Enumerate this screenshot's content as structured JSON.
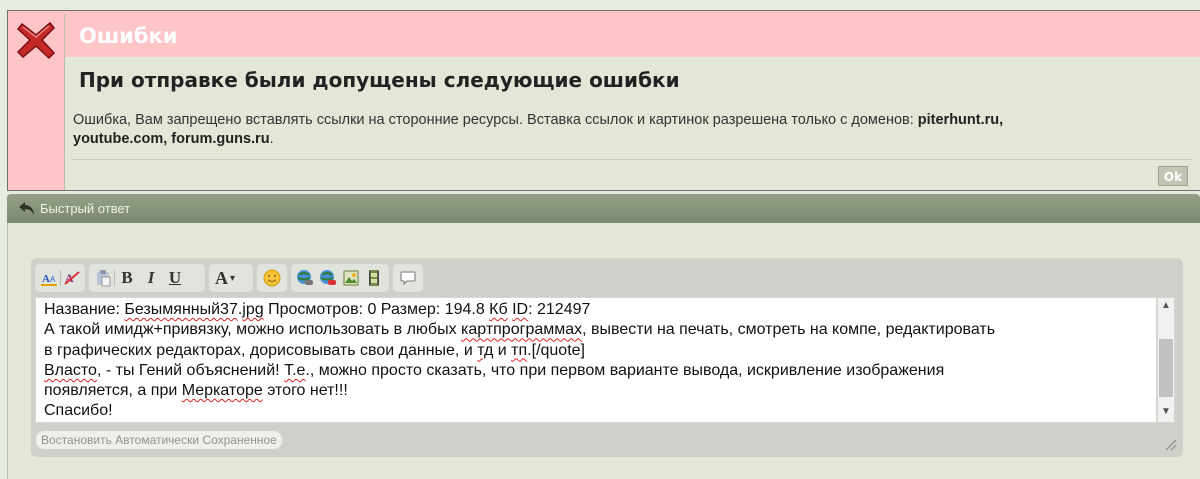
{
  "error_dialog": {
    "title": "Ошибки",
    "heading": "При отправке были допущены следующие ошибки",
    "message_text": "Ошибка, Вам запрещено вставлять ссылки на сторонние ресурсы. Вставка ссылок и картинок разрешена только с доменов: ",
    "allowed_domains_line1": "piterhunt.ru,",
    "allowed_domains_line2": "youtube.com, forum.guns.ru",
    "message_end": ".",
    "ok_label": "Ok",
    "colors": {
      "pink": "#fec5c8",
      "panel": "#e3e7d8",
      "icon_red": "#c0392b"
    }
  },
  "quick_reply": {
    "title": "Быстрый ответ",
    "header_color": "#87947b"
  },
  "toolbar": {
    "buttons": [
      "font-color-icon",
      "remove-format-icon",
      "paste-icon",
      "bold-icon",
      "italic-icon",
      "underline-icon",
      "font-size-icon",
      "smiley-icon",
      "insert-link-icon",
      "remove-link-icon",
      "insert-image-icon",
      "insert-video-icon",
      "quote-icon"
    ],
    "bold": "B",
    "italic": "I",
    "underline": "U",
    "font_size": "A",
    "font_size_arrow": "▾"
  },
  "editor": {
    "line1": "Название: Безымянный37.jpg Просмотров: 0 Размер: 194.8 Кб ID: 212497",
    "line2": "А такой имидж+привязку, можно использовать в любых картпрограммах, вывести на печать, смотреть на компе, редактировать",
    "line3": "в графических редакторах, дорисовывать свои данные, и тд и тп.[/quote]",
    "line4": "Власто, - ты Гений объяснений! Т.е., можно просто сказать, что при первом варианте вывода, искривление изображения",
    "line5": "появляется, а при Меркаторе этого нет!!!",
    "line6": "Спасибо!",
    "restore_label": "Востановить Автоматически Сохраненное"
  }
}
